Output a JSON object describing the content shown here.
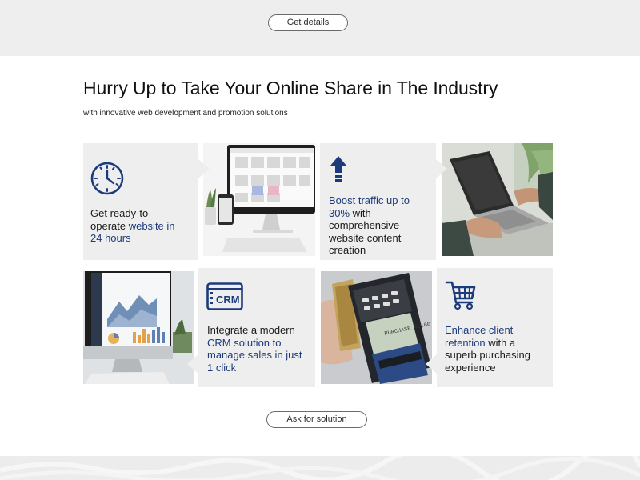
{
  "top": {
    "get_details_label": "Get details"
  },
  "hero": {
    "title": "Hurry Up to Take Your Online Share in The Industry",
    "subtitle": "with innovative web development and promotion solutions"
  },
  "features": [
    {
      "icon": "clock-icon",
      "parts": [
        "Get ready-to-operate ",
        "website in 24 hours",
        ""
      ]
    },
    {
      "icon": "arrow-up-icon",
      "parts": [
        "",
        "Boost traffic up to 30%",
        " with comprehensive website content creation"
      ]
    },
    {
      "icon": "crm-icon",
      "icon_text": "CRM",
      "parts": [
        "Integrate a modern ",
        "CRM solution to manage sales in just 1 click",
        ""
      ]
    },
    {
      "icon": "shopping-cart-icon",
      "parts": [
        "",
        "Enhance client retention",
        " with a superb purchasing experience"
      ]
    }
  ],
  "photos": [
    {
      "name": "photo-desktop-monitor-ecommerce"
    },
    {
      "name": "photo-laptop-typing"
    },
    {
      "name": "photo-analytics-monitor"
    },
    {
      "name": "photo-card-payment-terminal",
      "screen_text": "PURCHASE 45.60"
    }
  ],
  "cta": {
    "ask_label": "Ask for solution"
  },
  "colors": {
    "accent": "#1c3b7a",
    "tile_bg": "#eeeeee",
    "band_bg": "#eeeeee"
  }
}
